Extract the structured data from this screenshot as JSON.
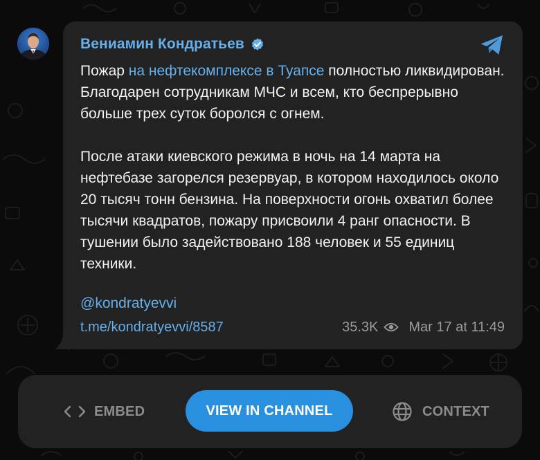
{
  "post": {
    "author": "Вениамин Кондратьев",
    "text_before_link": "Пожар ",
    "text_link": "на нефтекомплексе в Туапсе",
    "text_after_link": " полностью ликвидирован. Благодарен сотрудникам МЧС и всем, кто беспрерывно больше трех суток боролся с огнем.",
    "paragraph_2": "После атаки киевского режима в ночь на 14 марта на нефтебазе загорелся резервуар, в котором находилось около 20 тысяч тонн бензина. На поверхности огонь охватил более тысячи квадратов, пожару присвоили 4 ранг опасности. В тушении было задействовано 188 человек и 55 единиц техники.",
    "hashtag": "@kondratyevvi",
    "link": "t.me/kondratyevvi/8587",
    "views": "35.3K",
    "date": "Mar 17 at 11:49"
  },
  "actions": {
    "embed_label": "EMBED",
    "view_label": "VIEW IN CHANNEL",
    "context_label": "CONTEXT"
  },
  "colors": {
    "accent": "#2990e0",
    "link": "#64b0ec",
    "card_bg": "#222222",
    "page_bg": "#0b0b0b",
    "text": "#f2f2f2",
    "muted": "#9a9a9a"
  },
  "icons": {
    "verified": "verified-badge-icon",
    "telegram": "telegram-logo-icon",
    "views": "eye-icon",
    "embed": "code-brackets-icon",
    "context": "globe-icon"
  }
}
